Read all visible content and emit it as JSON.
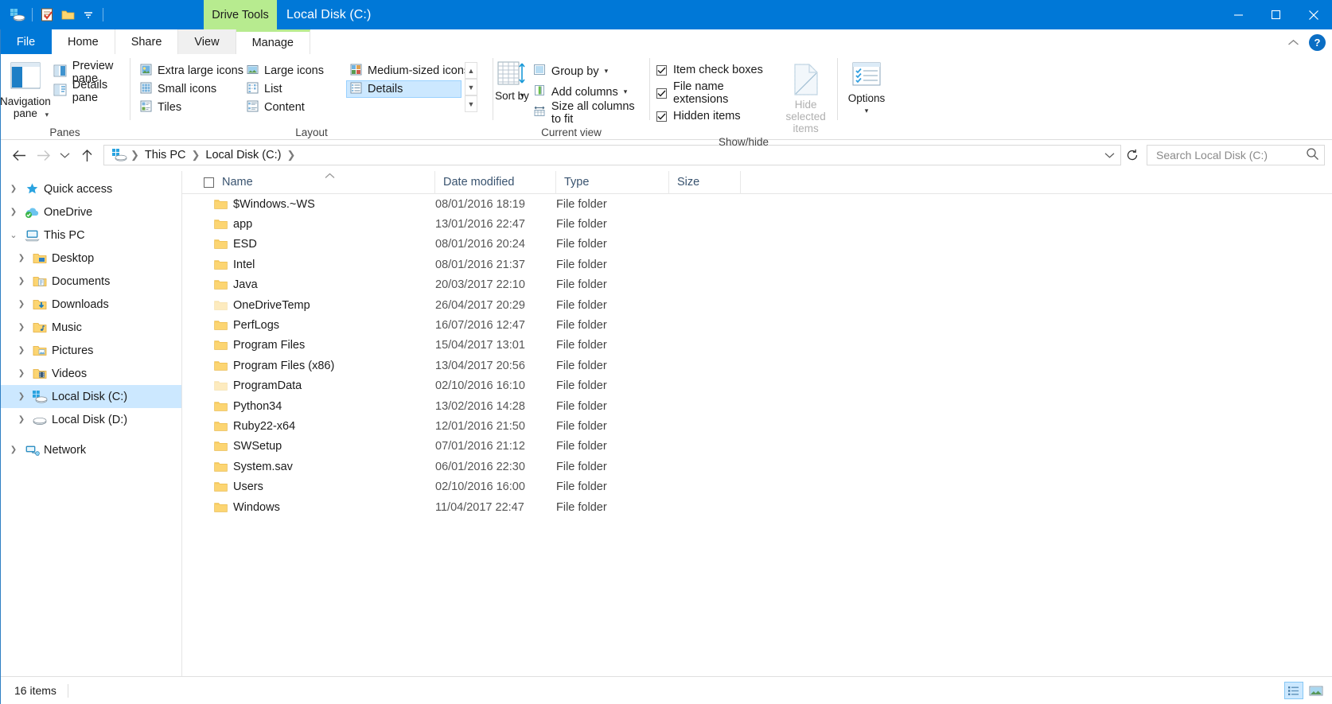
{
  "window": {
    "title": "Local Disk (C:)",
    "contextual_tab_group": "Drive Tools",
    "accent_color": "#0078d7",
    "contextual_color": "#b7eb8f"
  },
  "quick_access_toolbar": {
    "items": [
      {
        "name": "drive-icon",
        "label": "Local Disk (C:)"
      },
      {
        "name": "properties-icon",
        "label": "Properties"
      },
      {
        "name": "new-folder-icon",
        "label": "New folder"
      },
      {
        "name": "customize-icon",
        "label": "Customize Quick Access Toolbar"
      }
    ]
  },
  "window_controls": {
    "minimize": "Minimize",
    "maximize": "Maximize",
    "close": "Close"
  },
  "tabs": {
    "file": "File",
    "items": [
      {
        "label": "Home",
        "active": false
      },
      {
        "label": "Share",
        "active": false
      },
      {
        "label": "View",
        "active": true
      },
      {
        "label": "Manage",
        "active": false,
        "contextual": true
      }
    ],
    "collapse_ribbon": "Minimize the Ribbon",
    "help": "?"
  },
  "ribbon": {
    "groups": [
      {
        "name": "panes",
        "label": "Panes",
        "big_button": "Navigation pane",
        "small_buttons": [
          "Preview pane",
          "Details pane"
        ]
      },
      {
        "name": "layout",
        "label": "Layout",
        "items": [
          {
            "label": "Extra large icons",
            "selected": false
          },
          {
            "label": "Large icons",
            "selected": false
          },
          {
            "label": "Medium-sized icons",
            "selected": false
          },
          {
            "label": "Small icons",
            "selected": false
          },
          {
            "label": "List",
            "selected": false
          },
          {
            "label": "Details",
            "selected": true
          },
          {
            "label": "Tiles",
            "selected": false
          },
          {
            "label": "Content",
            "selected": false
          }
        ]
      },
      {
        "name": "current-view",
        "label": "Current view",
        "sort_by": "Sort by",
        "buttons": [
          "Group by",
          "Add columns",
          "Size all columns to fit"
        ]
      },
      {
        "name": "show-hide",
        "label": "Show/hide",
        "checkboxes": [
          {
            "label": "Item check boxes",
            "checked": true
          },
          {
            "label": "File name extensions",
            "checked": true
          },
          {
            "label": "Hidden items",
            "checked": true
          }
        ],
        "hide_selected_items": "Hide selected items",
        "hide_selected_disabled": true
      },
      {
        "name": "options",
        "label": "",
        "big_button": "Options"
      }
    ]
  },
  "address_bar": {
    "back": "Back",
    "forward": "Forward",
    "recent": "Recent locations",
    "up": "Up to This PC",
    "breadcrumbs": [
      "This PC",
      "Local Disk (C:)"
    ],
    "dropdown": "Previous locations",
    "refresh": "Refresh Local Disk (C:)",
    "search_placeholder": "Search Local Disk (C:)",
    "search_value": ""
  },
  "navigation_pane": {
    "items": [
      {
        "label": "Quick access",
        "icon": "star-icon",
        "indent": 0,
        "expanded": false,
        "selected": false
      },
      {
        "label": "OneDrive",
        "icon": "cloud-icon",
        "indent": 0,
        "expanded": false,
        "selected": false
      },
      {
        "label": "This PC",
        "icon": "pc-icon",
        "indent": 0,
        "expanded": true,
        "selected": false
      },
      {
        "label": "Desktop",
        "icon": "desktop-folder-icon",
        "indent": 1,
        "expanded": false,
        "selected": false
      },
      {
        "label": "Documents",
        "icon": "documents-folder-icon",
        "indent": 1,
        "expanded": false,
        "selected": false
      },
      {
        "label": "Downloads",
        "icon": "downloads-folder-icon",
        "indent": 1,
        "expanded": false,
        "selected": false
      },
      {
        "label": "Music",
        "icon": "music-folder-icon",
        "indent": 1,
        "expanded": false,
        "selected": false
      },
      {
        "label": "Pictures",
        "icon": "pictures-folder-icon",
        "indent": 1,
        "expanded": false,
        "selected": false
      },
      {
        "label": "Videos",
        "icon": "videos-folder-icon",
        "indent": 1,
        "expanded": false,
        "selected": false
      },
      {
        "label": "Local Disk (C:)",
        "icon": "windows-drive-icon",
        "indent": 1,
        "expanded": false,
        "selected": true
      },
      {
        "label": "Local Disk (D:)",
        "icon": "drive-icon",
        "indent": 1,
        "expanded": false,
        "selected": false
      },
      {
        "label": "Network",
        "icon": "network-icon",
        "indent": 0,
        "expanded": false,
        "selected": false
      }
    ]
  },
  "file_list": {
    "columns": [
      {
        "label": "Name",
        "sorted": "asc"
      },
      {
        "label": "Date modified",
        "sorted": null
      },
      {
        "label": "Type",
        "sorted": null
      },
      {
        "label": "Size",
        "sorted": null
      }
    ],
    "select_all_checked": false,
    "rows": [
      {
        "name": "$Windows.~WS",
        "date": "08/01/2016 18:19",
        "type": "File folder",
        "size": "",
        "hidden": false
      },
      {
        "name": "app",
        "date": "13/01/2016 22:47",
        "type": "File folder",
        "size": "",
        "hidden": false
      },
      {
        "name": "ESD",
        "date": "08/01/2016 20:24",
        "type": "File folder",
        "size": "",
        "hidden": false
      },
      {
        "name": "Intel",
        "date": "08/01/2016 21:37",
        "type": "File folder",
        "size": "",
        "hidden": false
      },
      {
        "name": "Java",
        "date": "20/03/2017 22:10",
        "type": "File folder",
        "size": "",
        "hidden": false
      },
      {
        "name": "OneDriveTemp",
        "date": "26/04/2017 20:29",
        "type": "File folder",
        "size": "",
        "hidden": true
      },
      {
        "name": "PerfLogs",
        "date": "16/07/2016 12:47",
        "type": "File folder",
        "size": "",
        "hidden": false
      },
      {
        "name": "Program Files",
        "date": "15/04/2017 13:01",
        "type": "File folder",
        "size": "",
        "hidden": false
      },
      {
        "name": "Program Files (x86)",
        "date": "13/04/2017 20:56",
        "type": "File folder",
        "size": "",
        "hidden": false
      },
      {
        "name": "ProgramData",
        "date": "02/10/2016 16:10",
        "type": "File folder",
        "size": "",
        "hidden": true
      },
      {
        "name": "Python34",
        "date": "13/02/2016 14:28",
        "type": "File folder",
        "size": "",
        "hidden": false
      },
      {
        "name": "Ruby22-x64",
        "date": "12/01/2016 21:50",
        "type": "File folder",
        "size": "",
        "hidden": false
      },
      {
        "name": "SWSetup",
        "date": "07/01/2016 21:12",
        "type": "File folder",
        "size": "",
        "hidden": false
      },
      {
        "name": "System.sav",
        "date": "06/01/2016 22:30",
        "type": "File folder",
        "size": "",
        "hidden": false
      },
      {
        "name": "Users",
        "date": "02/10/2016 16:00",
        "type": "File folder",
        "size": "",
        "hidden": false
      },
      {
        "name": "Windows",
        "date": "11/04/2017 22:47",
        "type": "File folder",
        "size": "",
        "hidden": false
      }
    ]
  },
  "status_bar": {
    "item_count": "16 items",
    "view_buttons": [
      {
        "name": "details-view-button",
        "label": "Details view",
        "selected": true
      },
      {
        "name": "large-icons-view-button",
        "label": "Large icons view",
        "selected": false
      }
    ]
  }
}
